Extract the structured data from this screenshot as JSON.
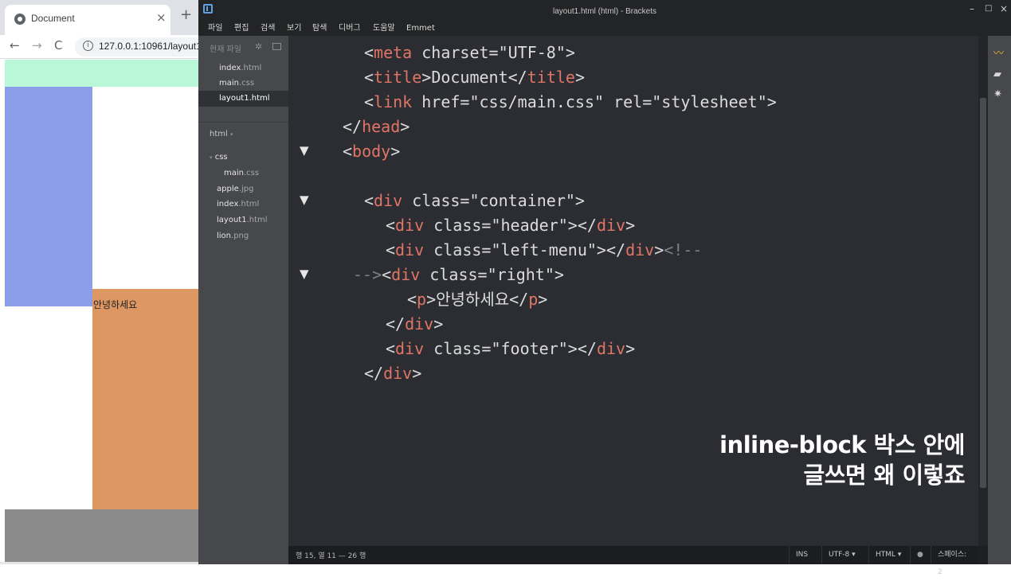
{
  "browser": {
    "tab_title": "Document",
    "tab_close": "×",
    "new_tab": "+",
    "back": "←",
    "forward": "→",
    "reload": "C",
    "info": "i",
    "url": "127.0.0.1:10961/layout1",
    "page_text": "안녕하세요",
    "colors": {
      "header": "#b9f7d8",
      "left_menu": "#8d9ee8",
      "right": "#dd9762",
      "footer": "#8b8b8b"
    }
  },
  "brackets": {
    "window_title": "layout1.html (html) - Brackets",
    "controls": {
      "minimize": "–",
      "maximize": "□",
      "close": "×"
    },
    "menu": [
      "파일",
      "편집",
      "검색",
      "보기",
      "탐색",
      "디버그",
      "도움말",
      "Emmet"
    ],
    "sidebar": {
      "working_files_label": "현재 파일",
      "working_files": [
        {
          "name": "index",
          "ext": ".html"
        },
        {
          "name": "main",
          "ext": ".css"
        },
        {
          "name": "layout1",
          "ext": ".html"
        }
      ],
      "project": "html",
      "tree": [
        {
          "name": "css",
          "ext": "",
          "type": "folder"
        },
        {
          "name": "main",
          "ext": ".css",
          "type": "file"
        },
        {
          "name": "apple",
          "ext": ".jpg",
          "type": "file"
        },
        {
          "name": "index",
          "ext": ".html",
          "type": "file"
        },
        {
          "name": "layout1",
          "ext": ".html",
          "type": "file"
        },
        {
          "name": "lion",
          "ext": ".png",
          "type": "file"
        }
      ]
    },
    "code": [
      "<meta charset=\"UTF-8\">",
      "<title>Document</title>",
      "<link href=\"css/main.css\" rel=\"stylesheet\">",
      "</head>",
      "<body>",
      "",
      "<div class=\"container\">",
      "<div class=\"header\"></div>",
      "<div class=\"left-menu\"></div><!--",
      "--><div class=\"right\">",
      "<p>안녕하세요</p>",
      "</div>",
      "<div class=\"footer\"></div>",
      "</div>"
    ],
    "overlay_caption": [
      "inline-block 박스 안에",
      "글쓰면 왜 이렇죠"
    ],
    "status": {
      "position": "행 15, 열 11 — 26 행",
      "ins": "INS",
      "encoding": "UTF-8 ▾",
      "language": "HTML ▾",
      "lint": "●",
      "spaces": "스페이스: 2"
    }
  }
}
